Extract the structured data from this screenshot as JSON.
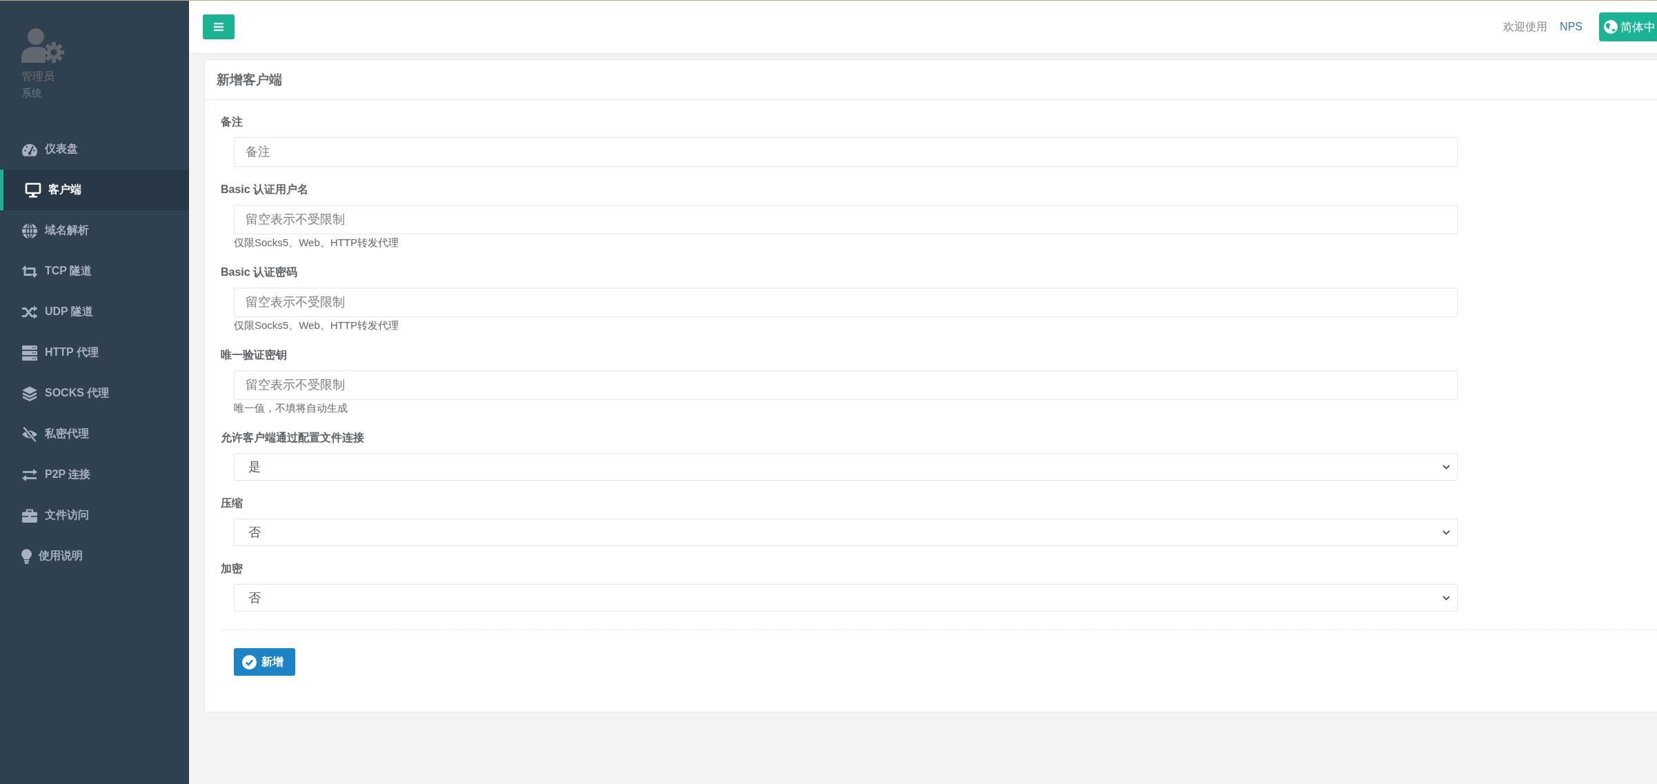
{
  "sidebar": {
    "profile": {
      "name": "管理员",
      "role": "系统"
    },
    "items": [
      {
        "label": "仪表盘",
        "selected": false
      },
      {
        "label": "客户端",
        "selected": true
      },
      {
        "label": "域名解析",
        "selected": false
      },
      {
        "label": "TCP 隧道",
        "selected": false
      },
      {
        "label": "UDP 隧道",
        "selected": false
      },
      {
        "label": "HTTP 代理",
        "selected": false
      },
      {
        "label": "SOCKS 代理",
        "selected": false
      },
      {
        "label": "私密代理",
        "selected": false
      },
      {
        "label": "P2P 连接",
        "selected": false
      },
      {
        "label": "文件访问",
        "selected": false
      },
      {
        "label": "使用说明",
        "selected": false
      }
    ]
  },
  "top_bar": {
    "welcome_text": "欢迎使用",
    "brand_link": "NPS",
    "language_button": "简体中"
  },
  "form": {
    "title": "新增客户端",
    "fields": [
      {
        "kind": "text",
        "label": "备注",
        "placeholder": "备注"
      },
      {
        "kind": "text",
        "label": "Basic 认证用户名",
        "placeholder": "留空表示不受限制",
        "help": "仅限Socks5、Web、HTTP转发代理"
      },
      {
        "kind": "text",
        "label": "Basic 认证密码",
        "placeholder": "留空表示不受限制",
        "help": "仅限Socks5、Web、HTTP转发代理"
      },
      {
        "kind": "text",
        "label": "唯一验证密钥",
        "placeholder": "留空表示不受限制",
        "help": "唯一值，不填将自动生成"
      },
      {
        "kind": "select",
        "label": "允许客户端通过配置文件连接",
        "value": "是"
      },
      {
        "kind": "select",
        "label": "压缩",
        "value": "否"
      },
      {
        "kind": "select",
        "label": "加密",
        "value": "否"
      }
    ],
    "submit_button": "新增"
  }
}
